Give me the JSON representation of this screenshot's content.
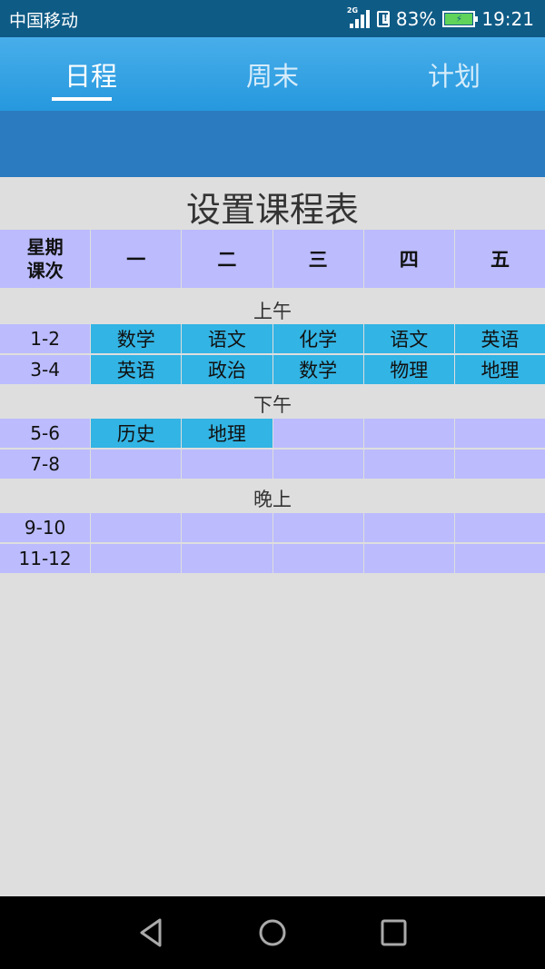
{
  "status_bar": {
    "carrier": "中国移动",
    "network": "2G",
    "battery": "83%",
    "time": "19:21"
  },
  "tabs": [
    {
      "label": "日程",
      "active": true
    },
    {
      "label": "周末",
      "active": false
    },
    {
      "label": "计划",
      "active": false
    }
  ],
  "title": "设置课程表",
  "table": {
    "corner": [
      "星期",
      "课次"
    ],
    "days": [
      "一",
      "二",
      "三",
      "四",
      "五"
    ],
    "sections": [
      {
        "label": "上午",
        "rows": [
          {
            "period": "1-2",
            "cells": [
              "数学",
              "语文",
              "化学",
              "语文",
              "英语"
            ]
          },
          {
            "period": "3-4",
            "cells": [
              "英语",
              "政治",
              "数学",
              "物理",
              "地理"
            ]
          }
        ]
      },
      {
        "label": "下午",
        "rows": [
          {
            "period": "5-6",
            "cells": [
              "历史",
              "地理",
              "",
              "",
              ""
            ]
          },
          {
            "period": "7-8",
            "cells": [
              "",
              "",
              "",
              "",
              ""
            ]
          }
        ]
      },
      {
        "label": "晚上",
        "rows": [
          {
            "period": "9-10",
            "cells": [
              "",
              "",
              "",
              "",
              ""
            ]
          },
          {
            "period": "11-12",
            "cells": [
              "",
              "",
              "",
              "",
              ""
            ]
          }
        ]
      }
    ]
  },
  "colors": {
    "status_bar": "#0e5b86",
    "tab_bar": "#2698de",
    "band": "#2a7bbf",
    "cell_empty": "#bbbbfd",
    "cell_filled": "#32b4e4",
    "background": "#dedede"
  },
  "nav": {
    "back": "back-icon",
    "home": "home-icon",
    "recents": "recents-icon"
  }
}
